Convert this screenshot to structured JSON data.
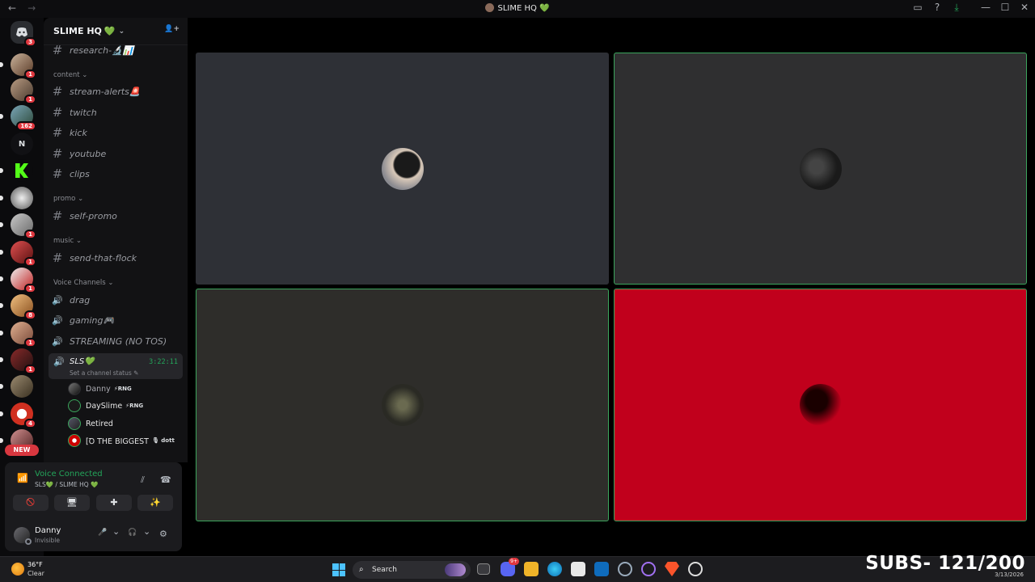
{
  "window": {
    "title": "SLIME HQ 💚",
    "nav_back": "←",
    "nav_forward": "→",
    "icons": [
      "inbox-icon",
      "help-icon",
      "download-icon",
      "minimize-icon",
      "maximize-icon",
      "close-icon"
    ],
    "controls": {
      "minimize": "—",
      "maximize": "☐",
      "close": "✕",
      "inbox": "▭",
      "help": "?",
      "download": "⤓"
    }
  },
  "guilds": {
    "badges": [
      "3",
      "1",
      "1",
      "162",
      "1",
      "1",
      "1",
      "8",
      "1",
      "1",
      "4"
    ],
    "letter": "N",
    "new_label": "NEW"
  },
  "server": {
    "name": "SLIME HQ",
    "heart": "💚",
    "chev": "⌄",
    "invite_icon": "👤+"
  },
  "channels": {
    "research": "research-🔬📊",
    "cat_content": "content ⌄",
    "stream_alerts": "stream-alerts🚨",
    "twitch": "twitch",
    "kick": "kick",
    "youtube": "youtube",
    "clips": "clips",
    "cat_promo": "promo ⌄",
    "self_promo": "self-promo",
    "cat_music": "music ⌄",
    "send_that_flock": "send-that-flock",
    "cat_voice": "Voice Channels ⌄",
    "drag": "drag",
    "gaming": "gaming🎮",
    "streaming": "STREAMING (NO TOS)",
    "sls": "SLS💚",
    "sls_time": "3:22:11",
    "sls_status": "Set a channel status ✎",
    "hash": "#",
    "speaker": "🔊"
  },
  "voice_users": [
    {
      "name": "Danny",
      "tag": "⚡RNG",
      "color": "#a9a9b0"
    },
    {
      "name": "DaySlime",
      "tag": "⚡RNG",
      "color": "#f2f3f5"
    },
    {
      "name": "Retired",
      "tag": "",
      "color": "#f2f3f5"
    },
    {
      "name": "[Ꝺ THE BIGGEST",
      "tag": "🎙 dott",
      "color": "#f2f3f5"
    }
  ],
  "voice_panel": {
    "title": "Voice Connected",
    "subtitle": "SLS💚 / SLIME HQ 💚",
    "signal_icon": "📶",
    "noise_icon": "⫽",
    "disconnect_icon": "☎",
    "btn_camera": "🚫",
    "btn_screen": "🖥",
    "btn_activity": "✚",
    "btn_soundboard": "✨"
  },
  "user": {
    "name": "Danny",
    "status": "Invisible",
    "mic": "🎤",
    "headset": "🎧",
    "settings": "⚙",
    "chev": "⌄"
  },
  "tiles": [
    {
      "bg": "#2e3036",
      "speaking": false
    },
    {
      "bg": "#2f2f30",
      "speaking": true
    },
    {
      "bg": "#2e2d2a",
      "speaking": true
    },
    {
      "bg": "#c1001c",
      "speaking": true
    }
  ],
  "taskbar": {
    "temp": "36°F",
    "condition": "Clear",
    "search": "Search",
    "search_icon": "⌕",
    "subs": "SUBS- 121/200",
    "date": "3/13/2026",
    "discord_badge": "9+"
  }
}
